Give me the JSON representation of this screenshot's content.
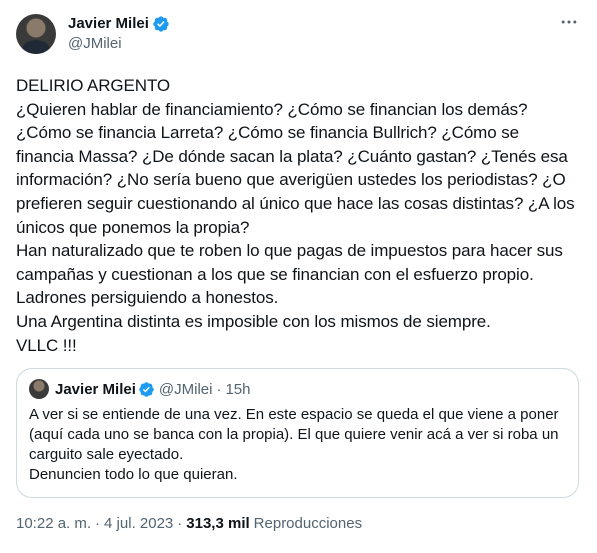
{
  "author": {
    "name": "Javier Milei",
    "handle": "@JMilei"
  },
  "tweet": {
    "text": "DELIRIO ARGENTO\n¿Quieren hablar de financiamiento? ¿Cómo se financian los demás? ¿Cómo se financia Larreta? ¿Cómo se financia Bullrich? ¿Cómo se financia Massa? ¿De dónde sacan la plata? ¿Cuánto gastan? ¿Tenés esa información? ¿No sería bueno que averigüen ustedes los periodistas? ¿O prefieren seguir cuestionando al único que hace las cosas distintas? ¿A los únicos que ponemos la propia?\nHan naturalizado que te roben lo que pagas de impuestos para hacer sus campañas y cuestionan a los que se financian con el esfuerzo propio.\nLadrones persiguiendo a honestos.\nUna Argentina distinta es imposible con los mismos de siempre.\nVLLC !!!"
  },
  "quoted": {
    "name": "Javier Milei",
    "handle": "@JMilei",
    "separator": "·",
    "time": "15h",
    "text": "A ver si se entiende de una vez. En este espacio se queda el que viene a poner (aquí cada uno se banca con la propia). El que quiere venir acá a ver si roba un carguito sale eyectado.\nDenuncien todo lo que quieran."
  },
  "meta": {
    "time": "10:22 a. m.",
    "separator": "·",
    "date": "4 jul. 2023",
    "views_count": "313,3 mil",
    "views_label": "Reproducciones"
  },
  "icons": {
    "verified": "verified-badge-icon",
    "more": "more-horizontal-icon"
  },
  "colors": {
    "accent": "#1d9bf0",
    "secondary_text": "#536471",
    "border": "#cfd9de"
  }
}
